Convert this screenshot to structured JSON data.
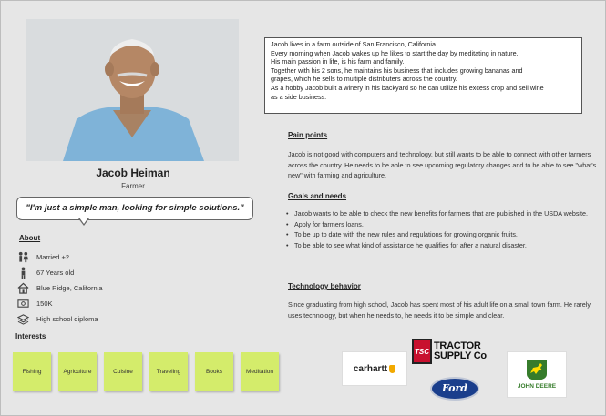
{
  "persona": {
    "name": "Jacob Heiman",
    "role": "Farmer",
    "quote": "\"I'm just a simple man, looking for simple solutions.\""
  },
  "about": {
    "heading": "About",
    "items": [
      {
        "icon": "people-icon",
        "text": "Married +2"
      },
      {
        "icon": "person-icon",
        "text": "67 Years old"
      },
      {
        "icon": "home-icon",
        "text": "Blue Ridge, California"
      },
      {
        "icon": "money-icon",
        "text": "150K"
      },
      {
        "icon": "books-icon",
        "text": "High school diploma"
      }
    ]
  },
  "interests": {
    "heading": "Interests",
    "items": [
      "Fishing",
      "Agriculture",
      "Cuisine",
      "Traveling",
      "Books",
      "Meditation"
    ]
  },
  "bio": {
    "lines": [
      "Jacob lives in a farm outside of San Francisco, California.",
      "Every morning when Jacob wakes up he likes to start the day by meditating in nature.",
      "His main passion in life, is his farm and family.",
      "Together with his 2 sons, he maintains his business that includes growing bananas and",
      "grapes, which he sells to multiple distributers across the country.",
      "As a hobby Jacob built a winery in his backyard so he can utilize his excess crop and sell wine",
      "as a side business."
    ]
  },
  "pain_points": {
    "heading": "Pain points",
    "text": "Jacob is not good with computers and technology, but still wants to be able to connect with other farmers across the country. He needs to be able to see upcoming regulatory changes and to be able to see \"what's new\" with farming and agriculture."
  },
  "goals": {
    "heading": "Goals and needs",
    "items": [
      "Jacob wants to be able to check the new benefits for farmers that are published in the USDA website.",
      "Apply for farmers loans.",
      "To be up to date with the new rules and regulations for growing organic fruits.",
      "To be able to see what kind of assistance he qualifies for after a natural disaster."
    ]
  },
  "tech": {
    "heading": "Technology behavior",
    "text": "Since graduating from high school, Jacob has spent most of his adult life on a small town farm. He rarely uses technology, but when he needs to, he needs it to be simple and clear."
  },
  "brands": {
    "carhartt": "carhartt",
    "tsc_badge": "TSC",
    "tractor": "TRACTOR",
    "supply": "SUPPLY Co",
    "ford": "Ford",
    "john_deere": "JOHN DEERE"
  },
  "colors": {
    "sticky": "#d4ec6b",
    "background": "#e6e6e6",
    "tsc_red": "#c8102e",
    "ford_blue": "#1a3e8c",
    "deere_green": "#367c2b",
    "deere_yellow": "#ffde00",
    "carhartt_orange": "#f2a900"
  }
}
